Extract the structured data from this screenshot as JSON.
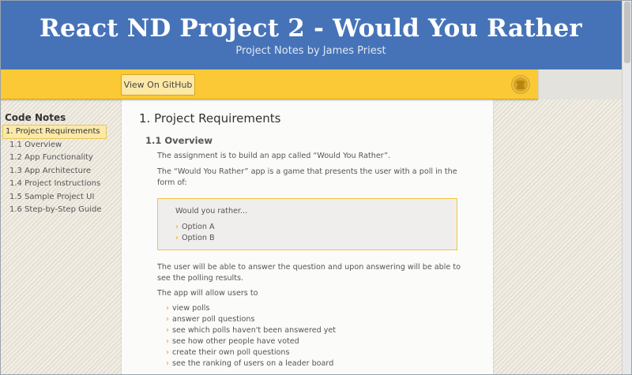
{
  "header": {
    "title": "React ND Project 2 - Would You Rather",
    "subtitle": "Project Notes by James Priest"
  },
  "toolbar": {
    "github_button_label": "View On GitHub",
    "github_icon": "github-octocat-icon"
  },
  "sidebar": {
    "title": "Code Notes",
    "items": [
      {
        "label": "1. Project Requirements",
        "active": true
      },
      {
        "label": "1.1 Overview"
      },
      {
        "label": "1.2 App Functionality"
      },
      {
        "label": "1.3 App Architecture"
      },
      {
        "label": "1.4 Project Instructions"
      },
      {
        "label": "1.5 Sample Project UI"
      },
      {
        "label": "1.6 Step-by-Step Guide"
      }
    ]
  },
  "content": {
    "heading": "1. Project Requirements",
    "subheading": "1.1 Overview",
    "para1": "The assignment is to build an app called “Would You Rather”.",
    "para2": "The “Would You Rather” app is a game that presents the user with a poll in the form of:",
    "callout": {
      "lead": "Would you rather...",
      "options": [
        "Option A",
        "Option B"
      ]
    },
    "para3": "The user will be able to answer the question and upon answering will be able to see the polling results.",
    "para4": "The app will allow users to",
    "bullets": [
      "view polls",
      "answer poll questions",
      "see which polls haven't been answered yet",
      "see how other people have voted",
      "create their own poll questions",
      "see the ranking of users on a leader board"
    ]
  },
  "colors": {
    "header_bg": "#4673b8",
    "accent_yellow": "#fbc936",
    "bullet_arrow": "#f0b63a"
  }
}
